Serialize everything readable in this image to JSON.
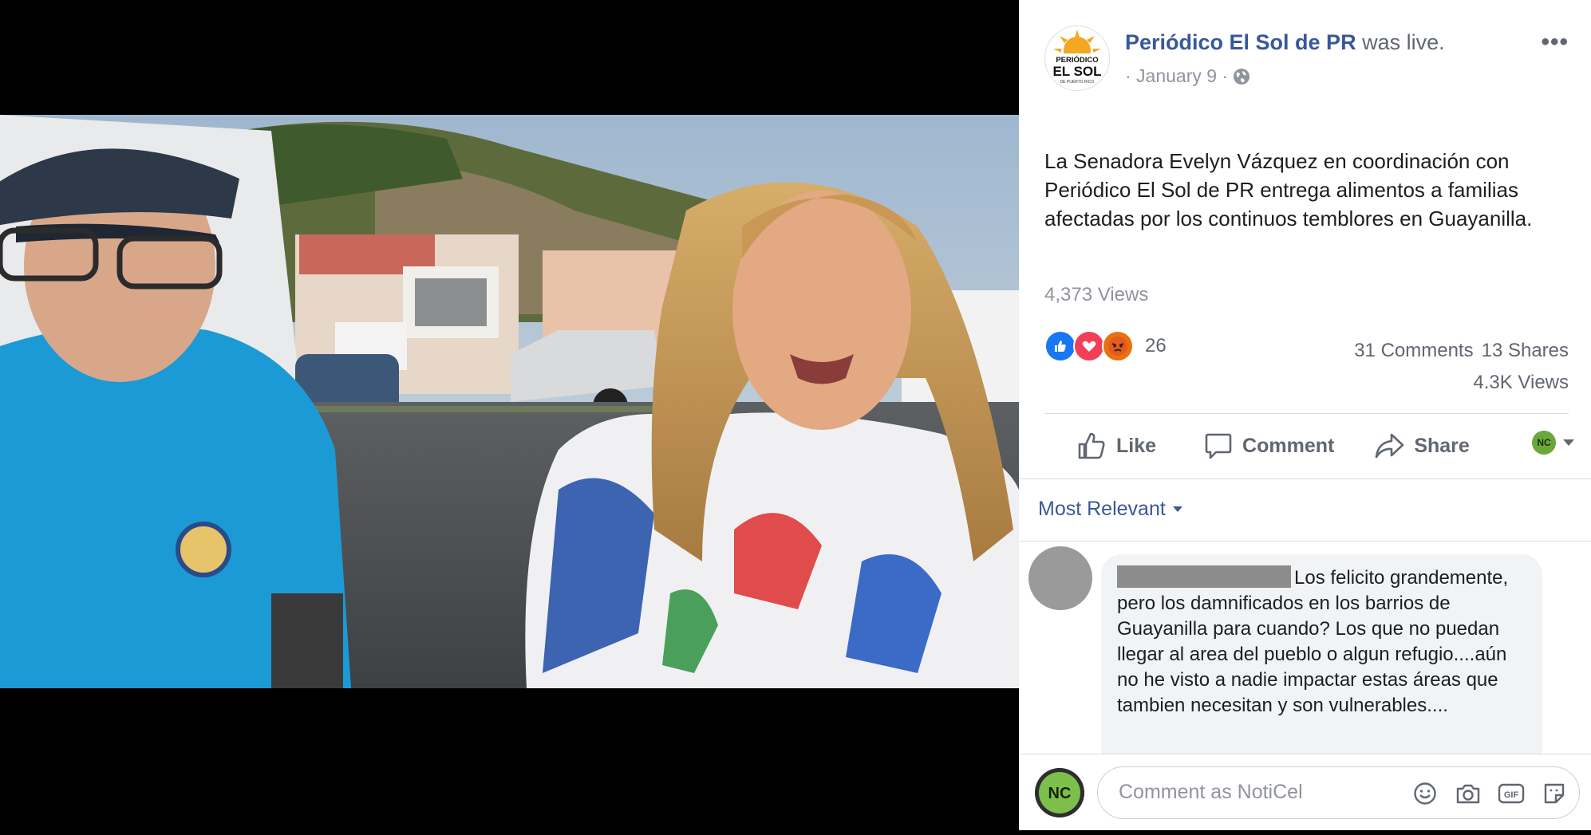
{
  "post": {
    "page_name": "Periódico El Sol de PR",
    "status_suffix": "was live.",
    "date": "· January 9 ·",
    "more_label": "•••",
    "text": "La Senadora Evelyn Vázquez en coordinación con Periódico El Sol de PR entrega alimentos a familias afectadas por los continuos temblores en Guayanilla.",
    "views": "4,373 Views",
    "reactions": {
      "count": "26",
      "types": [
        "like",
        "love",
        "angry"
      ]
    },
    "stats": {
      "comments": "31 Comments",
      "shares": "13 Shares",
      "views_short": "4.3K Views"
    },
    "logo": {
      "line1": "PERIÓDICO",
      "line2": "EL SOL",
      "line3": "DE PUERTO RICO"
    }
  },
  "actions": {
    "like": "Like",
    "comment": "Comment",
    "share": "Share"
  },
  "audience_avatar": "NC",
  "sort": {
    "label": "Most Relevant"
  },
  "comment": {
    "text": "Los felicito grandemente, pero los damnificados en los barrios de Guayanilla para cuando? Los que no puedan llegar al area del pueblo o algun refugio....aún no he visto a nadie impactar estas áreas que tambien necesitan y son vulnerables...."
  },
  "composer": {
    "avatar": "NC",
    "placeholder": "Comment as NotiCel",
    "icons": [
      "emoji-icon",
      "camera-icon",
      "gif-icon",
      "sticker-icon"
    ],
    "gif_label": "GIF"
  },
  "colors": {
    "link": "#385898",
    "muted": "#90949c",
    "like": "#1877f2",
    "love": "#f33e58",
    "angry": "#e9710f",
    "logo_orange": "#f5a623"
  }
}
